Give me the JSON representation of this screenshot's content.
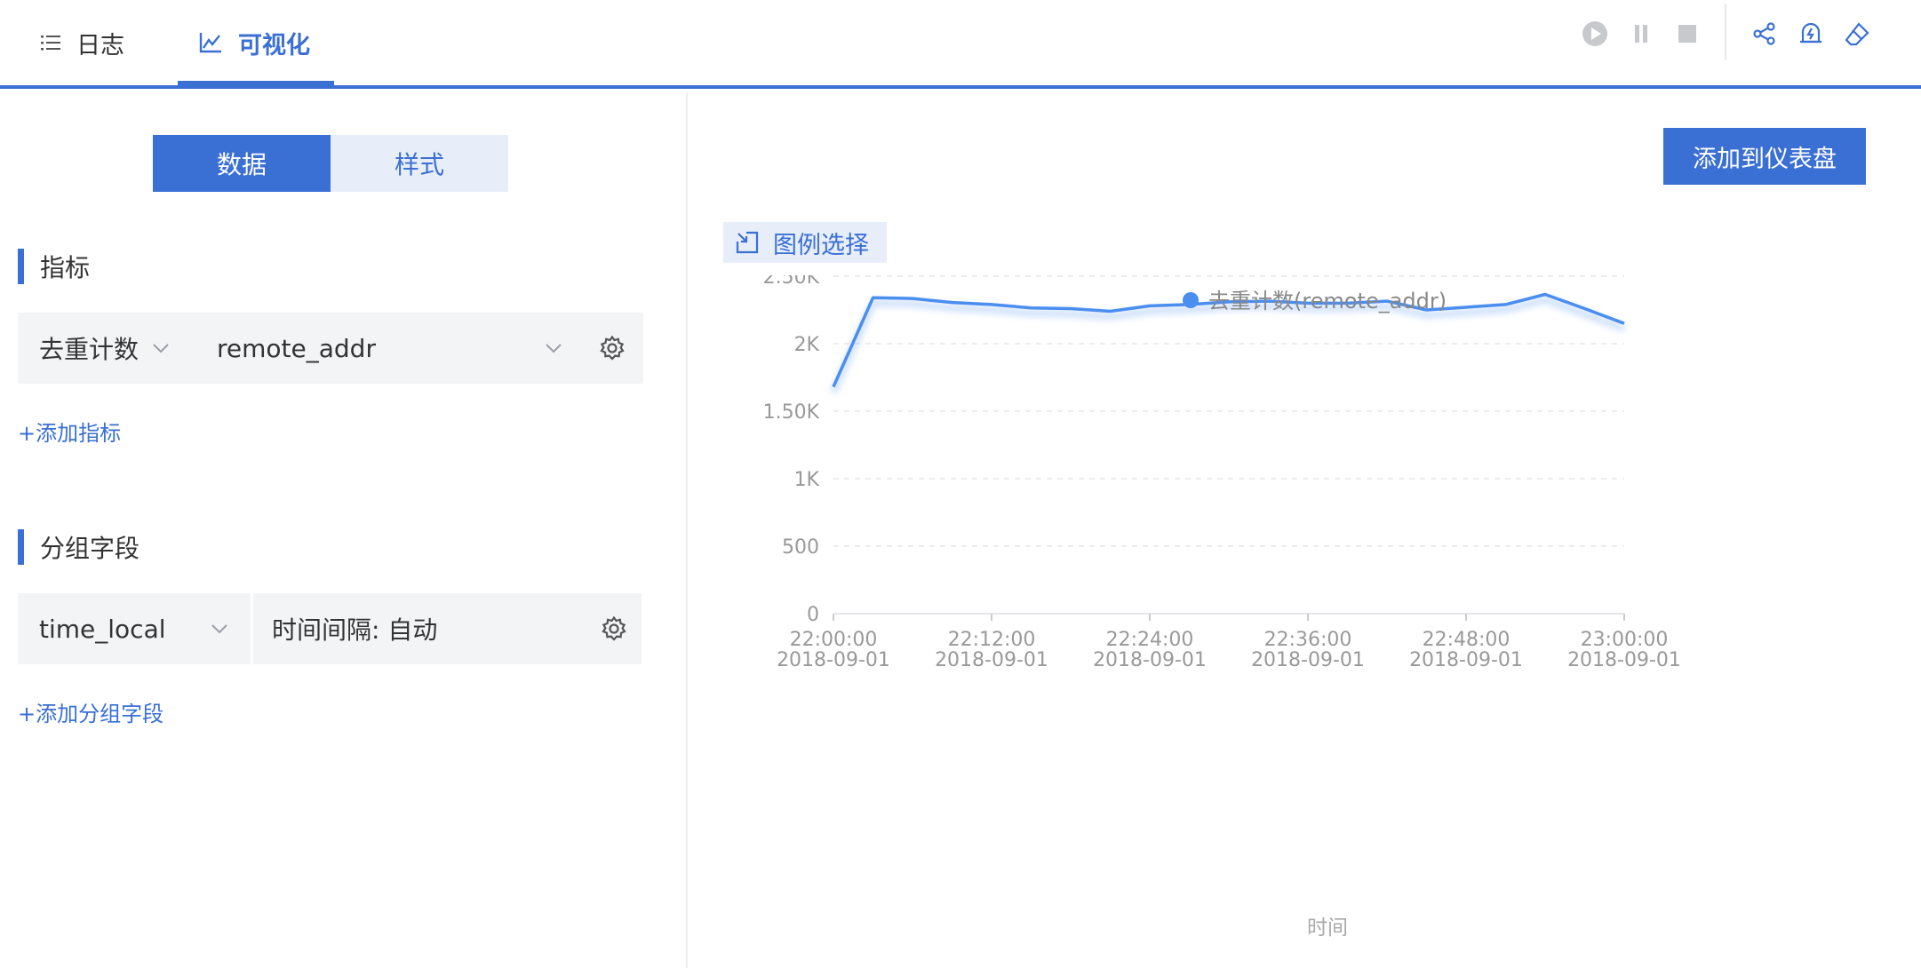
{
  "tabs": [
    {
      "label": "日志",
      "icon": "list-icon",
      "active": false
    },
    {
      "label": "可视化",
      "icon": "line-chart-icon",
      "active": true
    }
  ],
  "toolbar": {
    "icons": [
      "play-icon",
      "pause-icon",
      "stop-icon",
      "share-icon",
      "alert-bell-icon",
      "eraser-icon"
    ]
  },
  "left": {
    "segments": {
      "data": "数据",
      "style": "样式"
    },
    "metrics": {
      "title": "指标",
      "aggregation": "去重计数",
      "field": "remote_addr",
      "add_label": "+添加指标"
    },
    "group": {
      "title": "分组字段",
      "field": "time_local",
      "interval": "时间间隔: 自动",
      "add_label": "+添加分组字段"
    }
  },
  "right": {
    "add_dashboard_label": "添加到仪表盘",
    "legend_select_label": "图例选择"
  },
  "colors": {
    "accent": "#3a6fd4",
    "series": "#4a8ef0"
  },
  "chart_data": {
    "type": "line",
    "series": [
      {
        "name": "去重计数(remote_addr)",
        "x": [
          "22:00",
          "22:03",
          "22:06",
          "22:09",
          "22:12",
          "22:15",
          "22:18",
          "22:21",
          "22:24",
          "22:27",
          "22:30",
          "22:33",
          "22:36",
          "22:39",
          "22:42",
          "22:45",
          "22:48",
          "22:51",
          "22:54",
          "22:57",
          "23:00"
        ],
        "values": [
          1680,
          2340,
          2335,
          2305,
          2290,
          2265,
          2260,
          2240,
          2280,
          2290,
          2310,
          2315,
          2300,
          2300,
          2315,
          2250,
          2270,
          2290,
          2365,
          2260,
          2150
        ]
      }
    ],
    "ylim": [
      0,
      2500
    ],
    "yticks": [
      0,
      500,
      1000,
      1500,
      2000,
      2500
    ],
    "ytick_labels": [
      "0",
      "500",
      "1K",
      "1.50K",
      "2K",
      "2.50K"
    ],
    "xticks": [
      {
        "time": "22:00:00",
        "date": "2018-09-01",
        "minute": 0
      },
      {
        "time": "22:12:00",
        "date": "2018-09-01",
        "minute": 12
      },
      {
        "time": "22:24:00",
        "date": "2018-09-01",
        "minute": 24
      },
      {
        "time": "22:36:00",
        "date": "2018-09-01",
        "minute": 36
      },
      {
        "time": "22:48:00",
        "date": "2018-09-01",
        "minute": 48
      },
      {
        "time": "23:00:00",
        "date": "2018-09-01",
        "minute": 60
      }
    ],
    "xlabel": "时间",
    "ylabel": "",
    "grid": true,
    "legend": "top-center"
  }
}
